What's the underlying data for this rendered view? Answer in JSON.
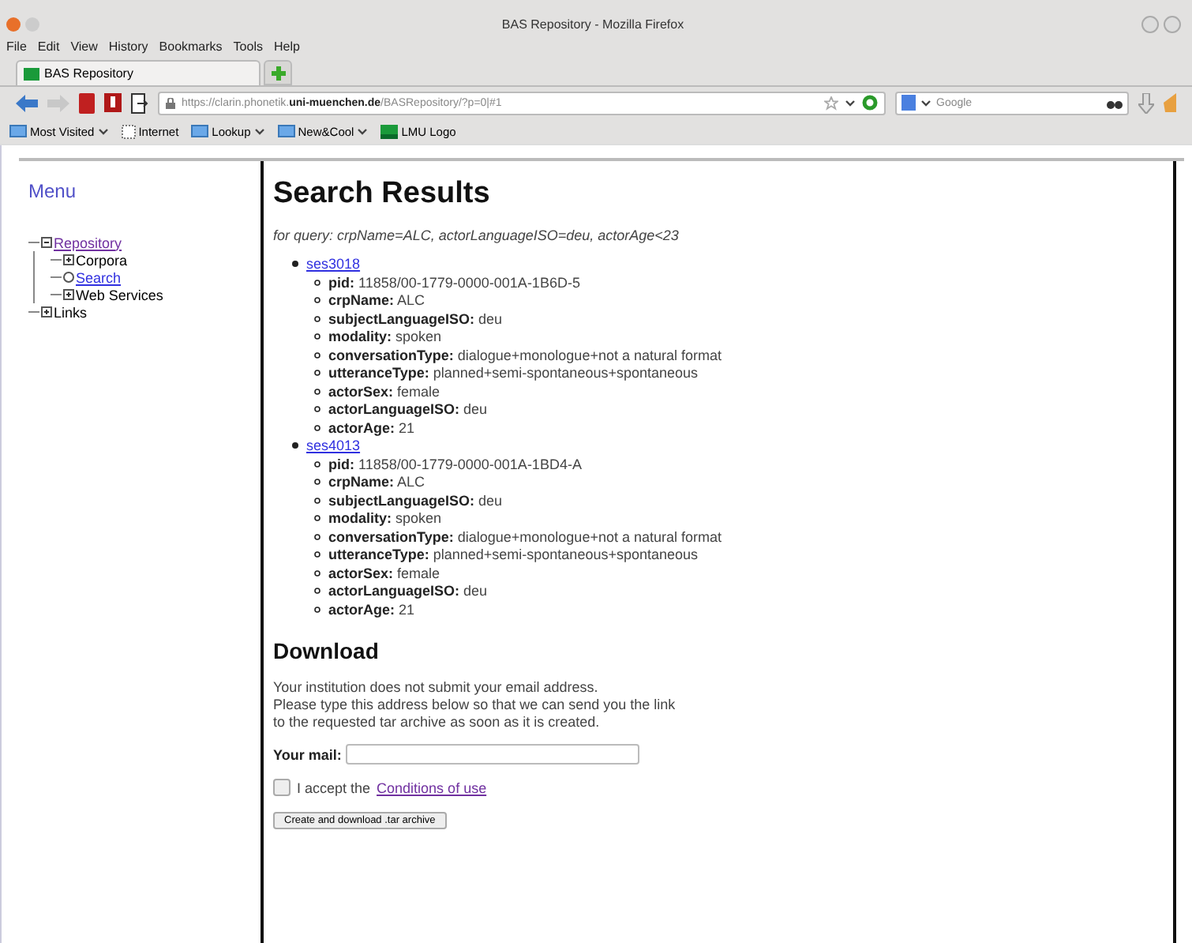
{
  "window": {
    "title": "BAS Repository - Mozilla Firefox"
  },
  "menu_bar": [
    "File",
    "Edit",
    "View",
    "History",
    "Bookmarks",
    "Tools",
    "Help"
  ],
  "tabs": [
    {
      "label": "BAS Repository",
      "selected": true
    }
  ],
  "url_bar": {
    "value": "https://clarin.phonetik.**uni-muenchen.de**/BASRepository/?p=0|#1"
  },
  "search_bar": {
    "placeholder": "Google"
  },
  "bookmarks": [
    {
      "label": "Most Visited",
      "kind": "menu"
    },
    {
      "label": "Internet",
      "kind": "page"
    },
    {
      "label": "Lookup",
      "kind": "menu"
    },
    {
      "label": "New&Cool",
      "kind": "menu"
    },
    {
      "label": "LMU Logo",
      "kind": "logo"
    }
  ],
  "sidebar": {
    "title": "Menu",
    "items": [
      {
        "label": "Repository",
        "kind": "folder",
        "expanded": true,
        "link": true,
        "children": [
          {
            "label": "Corpora",
            "kind": "folder",
            "expanded": false,
            "link": false
          },
          {
            "label": "Search",
            "kind": "page",
            "link": true
          },
          {
            "label": "Web Services",
            "kind": "folder",
            "expanded": false,
            "link": false
          }
        ]
      },
      {
        "label": "Links",
        "kind": "folder",
        "expanded": false,
        "link": false
      }
    ]
  },
  "results": {
    "title": "Search Results",
    "query_label": "for query:",
    "query": "crpName=ALC, actorLanguageISO=deu, actorAge<23",
    "sessions": [
      {
        "id": "ses3018",
        "fields": [
          {
            "name": "pid:",
            "value": "11858/00-1779-0000-001A-1B6D-5"
          },
          {
            "name": "crpName:",
            "value": "ALC"
          },
          {
            "name": "subjectLanguageISO:",
            "value": "deu"
          },
          {
            "name": "modality:",
            "value": "spoken"
          },
          {
            "name": "conversationType:",
            "value": "dialogue+monologue+not a natural format"
          },
          {
            "name": "utteranceType:",
            "value": "planned+semi-spontaneous+spontaneous"
          },
          {
            "name": "actorSex:",
            "value": "female"
          },
          {
            "name": "actorLanguageISO:",
            "value": "deu"
          },
          {
            "name": "actorAge:",
            "value": "21"
          }
        ]
      },
      {
        "id": "ses4013",
        "fields": [
          {
            "name": "pid:",
            "value": "11858/00-1779-0000-001A-1BD4-A"
          },
          {
            "name": "crpName:",
            "value": "ALC"
          },
          {
            "name": "subjectLanguageISO:",
            "value": "deu"
          },
          {
            "name": "modality:",
            "value": "spoken"
          },
          {
            "name": "conversationType:",
            "value": "dialogue+monologue+not a natural format"
          },
          {
            "name": "utteranceType:",
            "value": "planned+semi-spontaneous+spontaneous"
          },
          {
            "name": "actorSex:",
            "value": "female"
          },
          {
            "name": "actorLanguageISO:",
            "value": "deu"
          },
          {
            "name": "actorAge:",
            "value": "21"
          }
        ]
      }
    ]
  },
  "download": {
    "title": "Download",
    "notice": [
      "Your institution does not submit your email address.",
      "Please type this address below so that we can send you the link",
      "to the requested tar archive as soon as it is created."
    ],
    "mail_label": "Your mail:",
    "accept": {
      "checked": false,
      "label": "I accept the",
      "link": "Conditions of use"
    },
    "button": "Create and download .tar archive"
  }
}
